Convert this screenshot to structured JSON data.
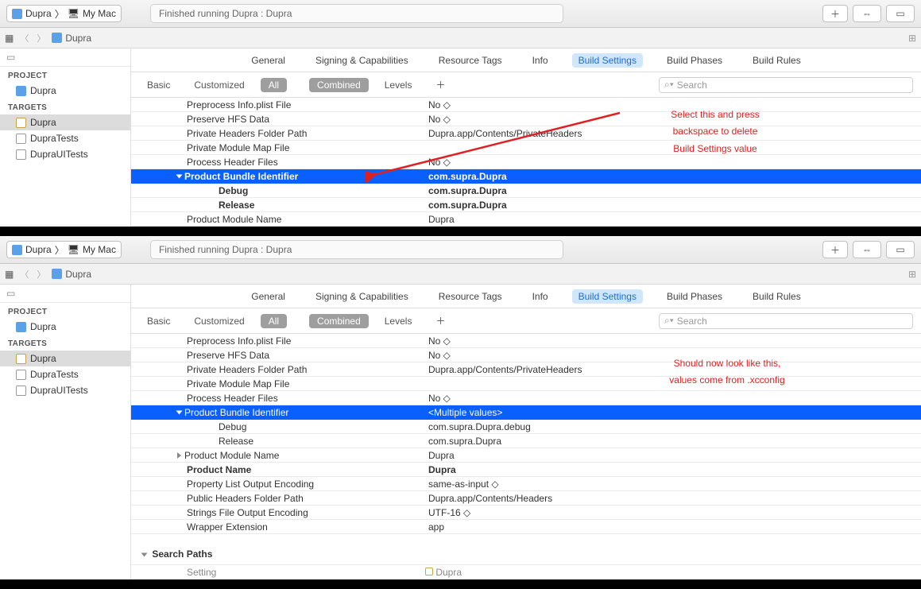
{
  "top": {
    "scheme": {
      "app": "Dupra",
      "dest": "My Mac"
    },
    "status": "Finished running Dupra : Dupra",
    "breadcrumb": {
      "project": "Dupra"
    },
    "sidebar": {
      "project_header": "PROJECT",
      "project_item": "Dupra",
      "targets_header": "TARGETS",
      "targets": [
        {
          "name": "Dupra",
          "selected": true
        },
        {
          "name": "DupraTests",
          "selected": false
        },
        {
          "name": "DupraUITests",
          "selected": false
        }
      ]
    },
    "tabs": [
      "General",
      "Signing & Capabilities",
      "Resource Tags",
      "Info",
      "Build Settings",
      "Build Phases",
      "Build Rules"
    ],
    "active_tab": "Build Settings",
    "filters": {
      "basic": "Basic",
      "customized": "Customized",
      "all": "All",
      "combined": "Combined",
      "levels": "Levels"
    },
    "search_placeholder": "Search",
    "rows": [
      {
        "key": "Preprocess Info.plist File",
        "val": "No ◇"
      },
      {
        "key": "Preserve HFS Data",
        "val": "No ◇"
      },
      {
        "key": "Private Headers Folder Path",
        "val": "Dupra.app/Contents/PrivateHeaders"
      },
      {
        "key": "Private Module Map File",
        "val": ""
      },
      {
        "key": "Process Header Files",
        "val": "No ◇"
      }
    ],
    "prod_id": {
      "label": "Product Bundle Identifier",
      "val": "com.supra.Dupra",
      "debug_label": "Debug",
      "debug_val": "com.supra.Dupra",
      "release_label": "Release",
      "release_val": "com.supra.Dupra"
    },
    "pmn": {
      "key": "Product Module Name",
      "val": "Dupra"
    },
    "annotation": "Select this and press\nbackspace to delete\nBuild Settings value"
  },
  "bottom": {
    "scheme": {
      "app": "Dupra",
      "dest": "My Mac"
    },
    "status": "Finished running Dupra : Dupra",
    "breadcrumb": {
      "project": "Dupra"
    },
    "sidebar": {
      "project_header": "PROJECT",
      "project_item": "Dupra",
      "targets_header": "TARGETS",
      "targets": [
        {
          "name": "Dupra",
          "selected": true
        },
        {
          "name": "DupraTests",
          "selected": false
        },
        {
          "name": "DupraUITests",
          "selected": false
        }
      ]
    },
    "tabs": [
      "General",
      "Signing & Capabilities",
      "Resource Tags",
      "Info",
      "Build Settings",
      "Build Phases",
      "Build Rules"
    ],
    "active_tab": "Build Settings",
    "filters": {
      "basic": "Basic",
      "customized": "Customized",
      "all": "All",
      "combined": "Combined",
      "levels": "Levels"
    },
    "search_placeholder": "Search",
    "rows": [
      {
        "key": "Preprocess Info.plist File",
        "val": "No ◇"
      },
      {
        "key": "Preserve HFS Data",
        "val": "No ◇"
      },
      {
        "key": "Private Headers Folder Path",
        "val": "Dupra.app/Contents/PrivateHeaders"
      },
      {
        "key": "Private Module Map File",
        "val": ""
      },
      {
        "key": "Process Header Files",
        "val": "No ◇"
      }
    ],
    "prod_id": {
      "label": "Product Bundle Identifier",
      "val": "<Multiple values>",
      "debug_label": "Debug",
      "debug_val": "com.supra.Dupra.debug",
      "release_label": "Release",
      "release_val": "com.supra.Dupra"
    },
    "after": [
      {
        "key": "Product Module Name",
        "val": "Dupra",
        "disc": true
      },
      {
        "key": "Product Name",
        "val": "Dupra",
        "bold": true
      },
      {
        "key": "Property List Output Encoding",
        "val": "same-as-input ◇"
      },
      {
        "key": "Public Headers Folder Path",
        "val": "Dupra.app/Contents/Headers"
      },
      {
        "key": "Strings File Output Encoding",
        "val": "UTF-16 ◇"
      },
      {
        "key": "Wrapper Extension",
        "val": "app"
      }
    ],
    "section": "Search Paths",
    "colhead": {
      "setting": "Setting",
      "target": "Dupra"
    },
    "annotation": "Should now look like this,\nvalues come from .xcconfig"
  }
}
